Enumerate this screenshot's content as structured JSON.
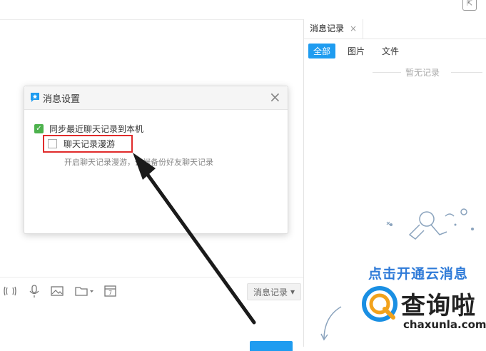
{
  "right_panel": {
    "tab_label": "消息记录",
    "tab_close": "×",
    "filters": [
      "全部",
      "图片",
      "文件"
    ],
    "empty_text": "暂无记录",
    "promo_title": "点击开通云消息",
    "promo_sub": "↗"
  },
  "dialog": {
    "title": "消息设置",
    "close": "×",
    "sync_label": "同步最近聊天记录到本机",
    "roam_label": "聊天记录漫游",
    "roam_desc": "开启聊天记录漫游，云端备份好友聊天记录"
  },
  "toolbar": {
    "history_label": "消息记录",
    "history_caret": "▾",
    "icons": [
      "shake-icon",
      "mic-icon",
      "image-icon",
      "folder-icon",
      "calendar-icon"
    ]
  },
  "watermark": {
    "brand": "查询啦",
    "domain": "chaxunla.com"
  },
  "colors": {
    "accent": "#1f9cf0",
    "check_green": "#4db24d",
    "highlight_red": "#e02b2b",
    "promo_blue": "#2f7bd8"
  }
}
